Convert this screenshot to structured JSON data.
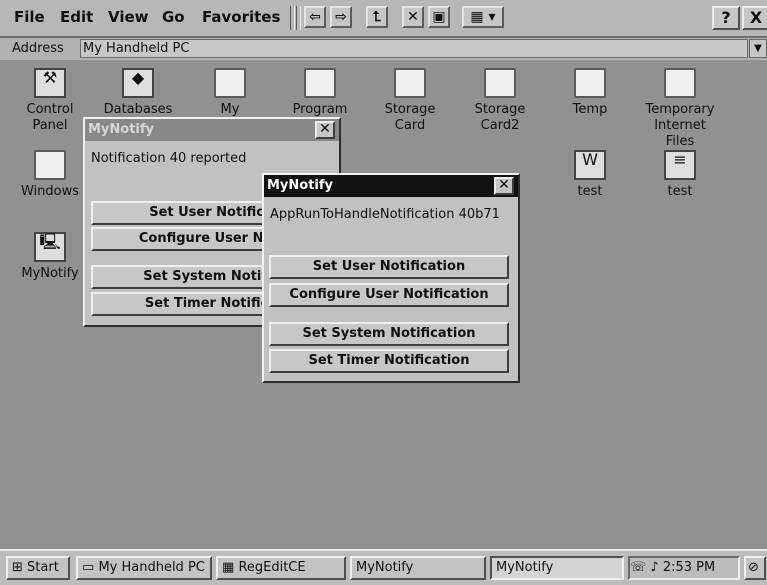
{
  "menubar": {
    "items": [
      "File",
      "Edit",
      "View",
      "Go",
      "Favorites"
    ],
    "help_label": "?",
    "close_label": "X"
  },
  "address": {
    "label": "Address",
    "value": "My Handheld PC"
  },
  "desktop_icons": [
    {
      "label": "Control Panel",
      "icon": "control-panel-icon"
    },
    {
      "label": "Databases",
      "icon": "database-icon"
    },
    {
      "label": "My Documents",
      "icon": "folder-icon"
    },
    {
      "label": "Program Files",
      "icon": "folder-icon"
    },
    {
      "label": "Storage Card",
      "icon": "folder-icon"
    },
    {
      "label": "Storage Card2",
      "icon": "folder-icon"
    },
    {
      "label": "Temp",
      "icon": "folder-icon"
    },
    {
      "label": "Temporary Internet Files",
      "icon": "folder-icon"
    },
    {
      "label": "Windows",
      "icon": "folder-icon"
    },
    {
      "label": "test",
      "icon": "word-document-icon"
    },
    {
      "label": "test",
      "icon": "text-document-icon"
    },
    {
      "label": "MyNotify",
      "icon": "mynotify-app-icon"
    }
  ],
  "window_back": {
    "title": "MyNotify",
    "message": "Notification 40 reported",
    "buttons": [
      "Set User Notifica",
      "Configure User Noti",
      "Set System Notific",
      "Set Timer Notifica"
    ]
  },
  "window_front": {
    "title": "MyNotify",
    "message": "AppRunToHandleNotification 40b71",
    "buttons": [
      "Set User Notification",
      "Configure User Notification",
      "Set System Notification",
      "Set Timer Notification"
    ]
  },
  "taskbar": {
    "start": "Start",
    "buttons": [
      "My Handheld PC",
      "RegEditCE",
      "MyNotify",
      "MyNotify"
    ],
    "clock": "2:53 PM"
  }
}
